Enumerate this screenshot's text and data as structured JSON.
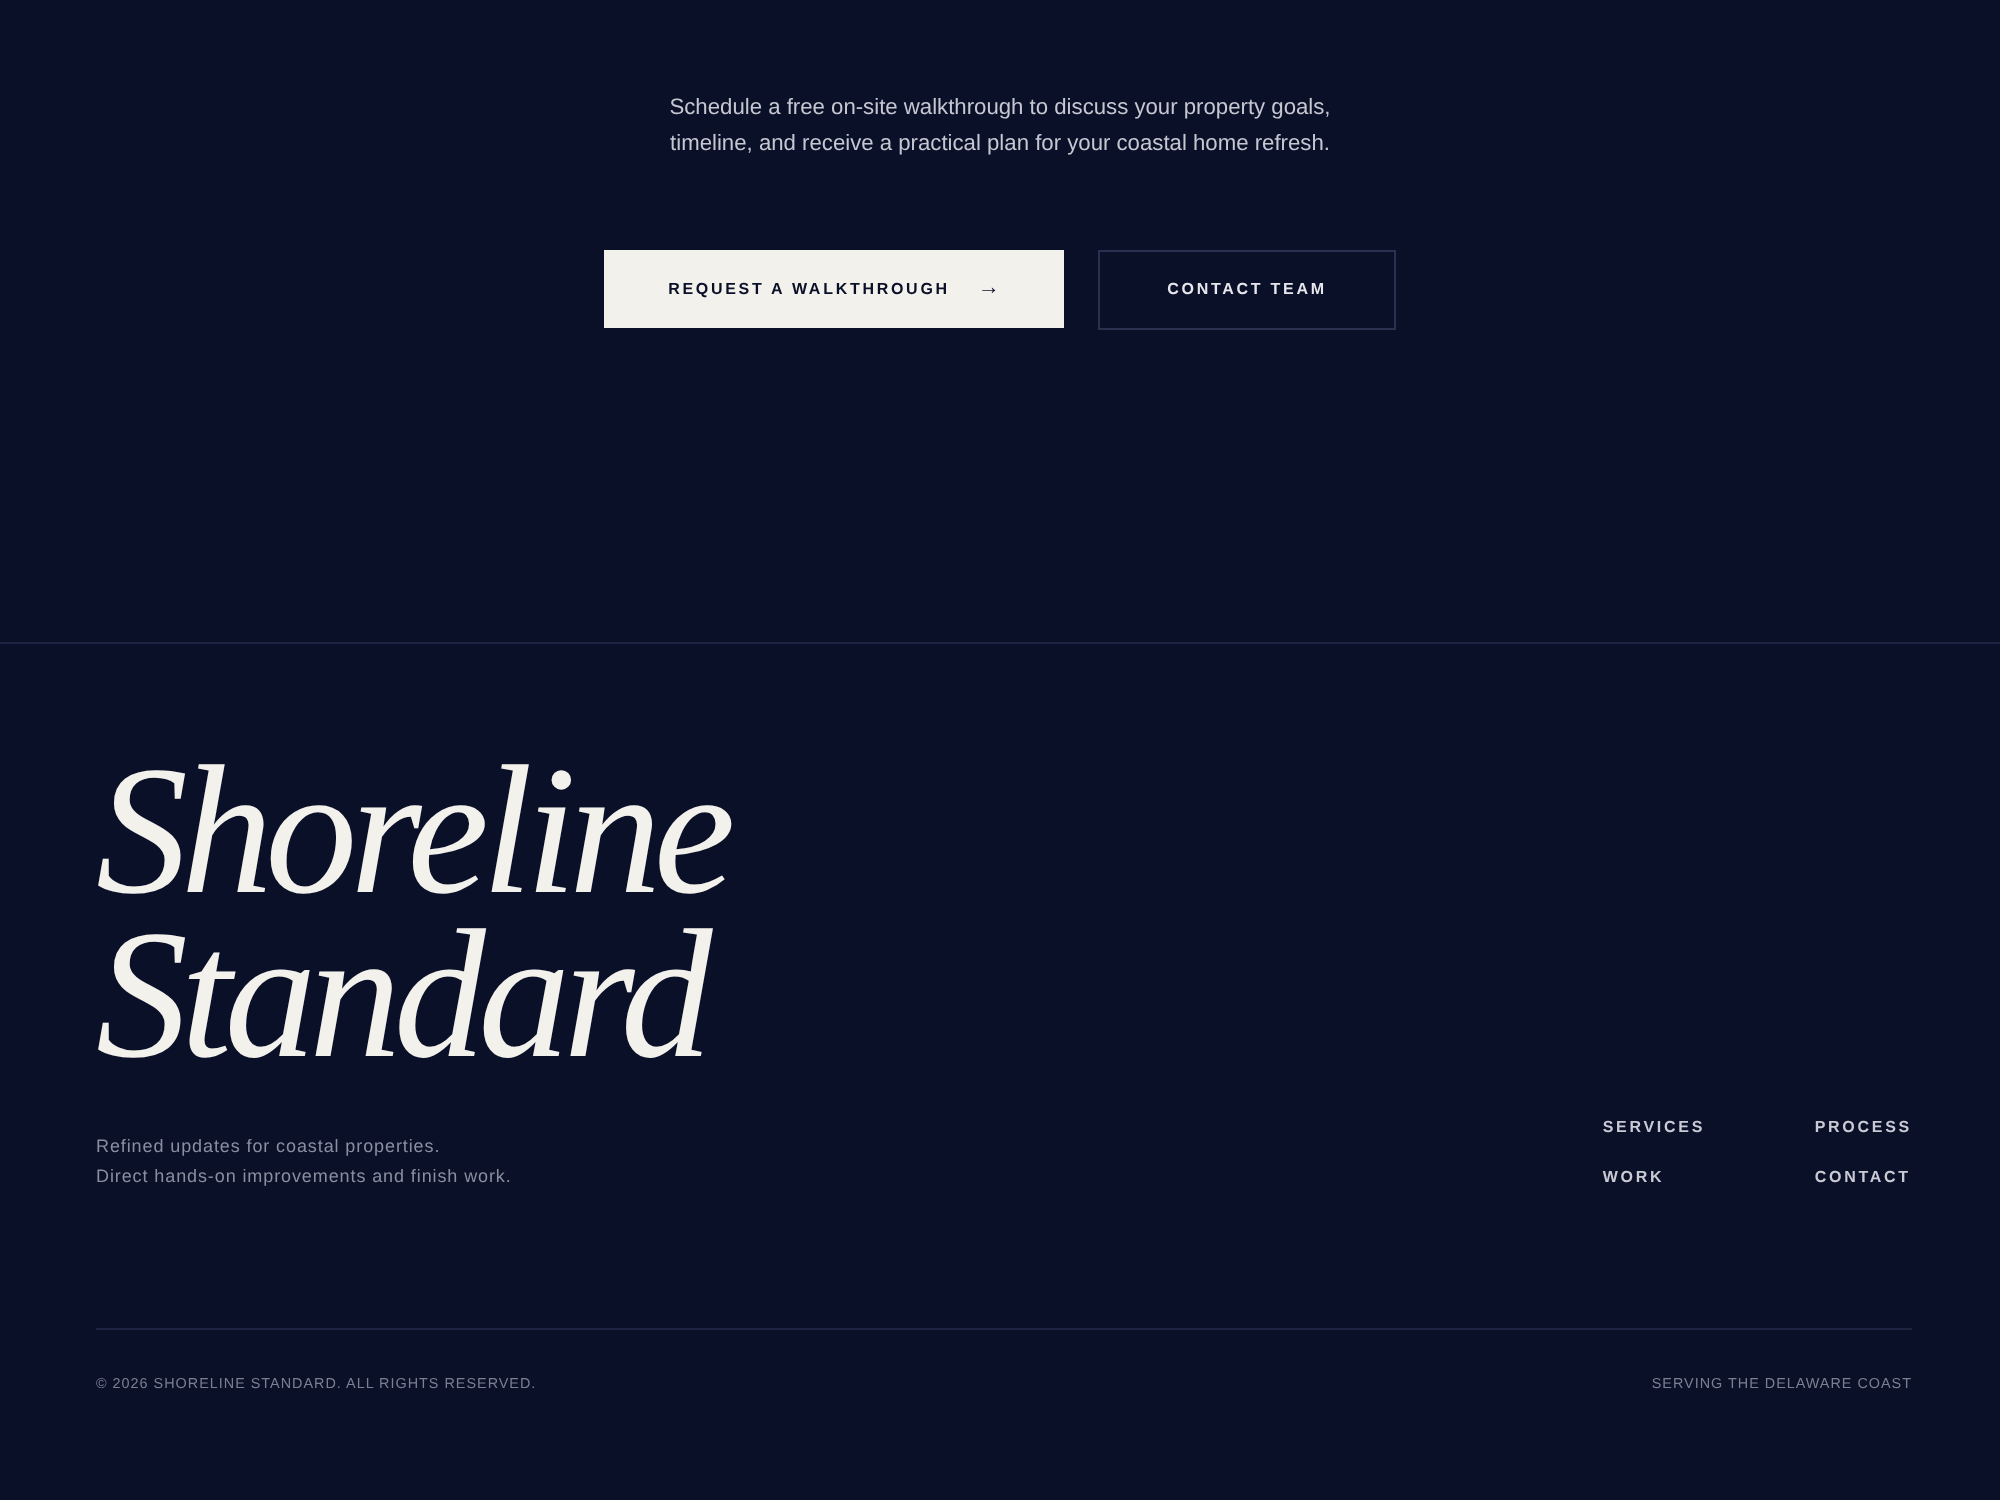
{
  "hero": {
    "description": "Schedule a free on-site walkthrough to discuss your property goals, timeline, and receive a practical plan for your coastal home refresh.",
    "buttons": [
      {
        "label": "REQUEST A WALKTHROUGH",
        "icon": "→",
        "kind": "primary"
      },
      {
        "label": "CONTACT TEAM",
        "kind": "secondary"
      }
    ]
  },
  "footer": {
    "brand": "Shoreline Standard",
    "tagline": [
      "Refined updates for coastal properties.",
      "Direct hands-on improvements and finish work."
    ],
    "nav": [
      "SERVICES",
      "PROCESS",
      "WORK",
      "CONTACT"
    ],
    "copyright": "© 2026 SHORELINE STANDARD. ALL RIGHTS RESERVED.",
    "service_area": "SERVING THE DELAWARE COAST"
  }
}
